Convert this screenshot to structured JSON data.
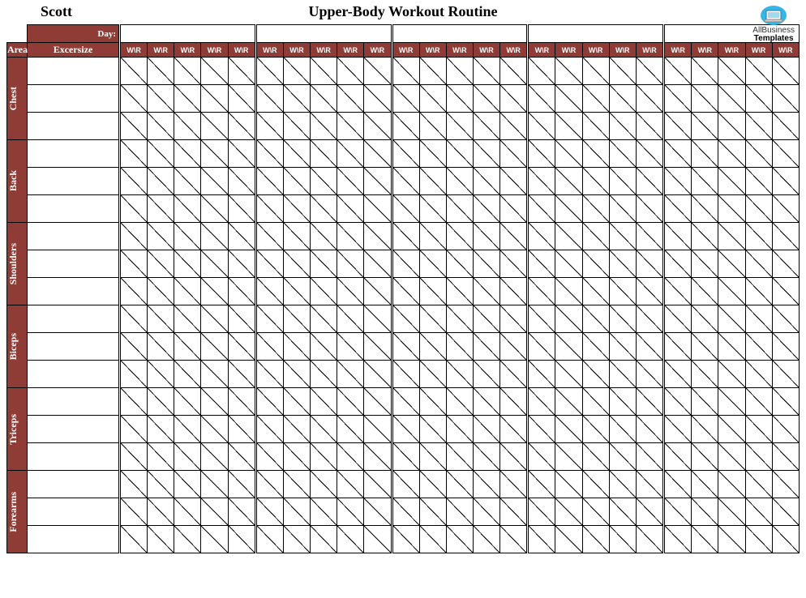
{
  "header": {
    "name": "Scott",
    "title": "Upper-Body Workout Routine",
    "day_label": "Day:",
    "area_label": "Area",
    "exercise_label": "Excersize",
    "wr_label": "W\\R"
  },
  "logo": {
    "line1": "AllBusiness",
    "line2": "Templates"
  },
  "areas": [
    {
      "label": "Chest",
      "rows": 3
    },
    {
      "label": "Back",
      "rows": 3
    },
    {
      "label": "Shoulders",
      "rows": 3
    },
    {
      "label": "Biceps",
      "rows": 3
    },
    {
      "label": "Triceps",
      "rows": 3
    },
    {
      "label": "Forearms",
      "rows": 3
    }
  ],
  "day_groups": 5,
  "subcols_per_group": 5
}
